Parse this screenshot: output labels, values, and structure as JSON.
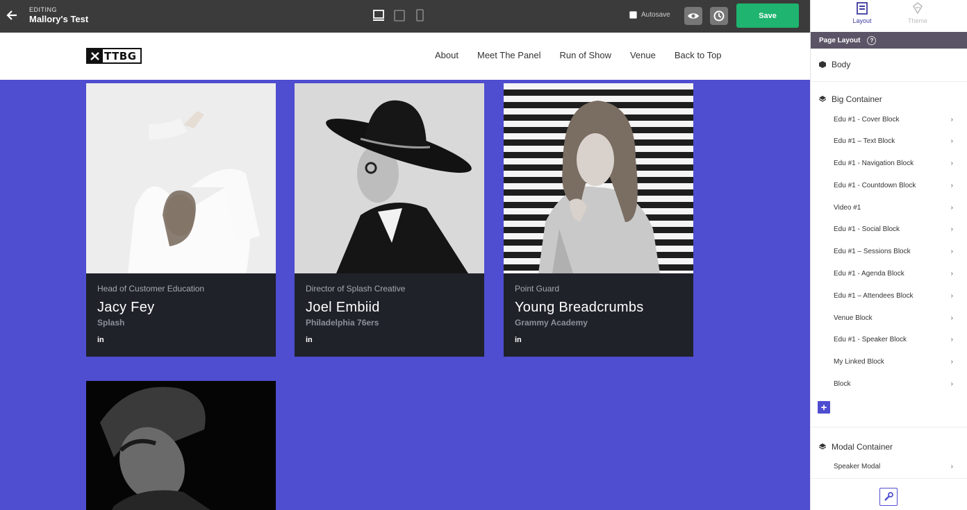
{
  "topbar": {
    "editing_label": "EDITING",
    "title": "Mallory's Test",
    "autosave_label": "Autosave",
    "save_label": "Save"
  },
  "site": {
    "logo_text": "TTBG",
    "nav": [
      "About",
      "Meet The Panel",
      "Run of Show",
      "Venue",
      "Back to Top"
    ],
    "speakers": [
      {
        "role": "Head of Customer Education",
        "name": "Jacy Fey",
        "org": "Splash",
        "social": "in"
      },
      {
        "role": "Director of Splash Creative",
        "name": "Joel Embiid",
        "org": "Philadelphia 76ers",
        "social": "in"
      },
      {
        "role": "Point Guard",
        "name": "Young Breadcrumbs",
        "org": "Grammy Academy",
        "social": "in"
      }
    ]
  },
  "panel": {
    "tabs": [
      {
        "label": "Layout"
      },
      {
        "label": "Theme"
      }
    ],
    "section_title": "Page Layout",
    "help": "?",
    "body_label": "Body",
    "big_container_label": "Big Container",
    "big_container_children": [
      "Edu #1 - Cover Block",
      "Edu #1 – Text Block",
      "Edu #1 - Navigation Block",
      "Edu #1 - Countdown Block",
      "Video #1",
      "Edu #1 - Social Block",
      "Edu #1 – Sessions Block",
      "Edu #1 - Agenda Block",
      "Edu #1 – Attendees Block",
      "Venue Block",
      "Edu #1 - Speaker Block",
      "My Linked Block",
      "Block"
    ],
    "modal_container_label": "Modal Container",
    "modal_children": [
      "Speaker Modal"
    ]
  },
  "colors": {
    "accent": "#4f4dd0",
    "save": "#1fb46f",
    "card_bg": "#1f2229",
    "topbar": "#3b3b3b"
  }
}
